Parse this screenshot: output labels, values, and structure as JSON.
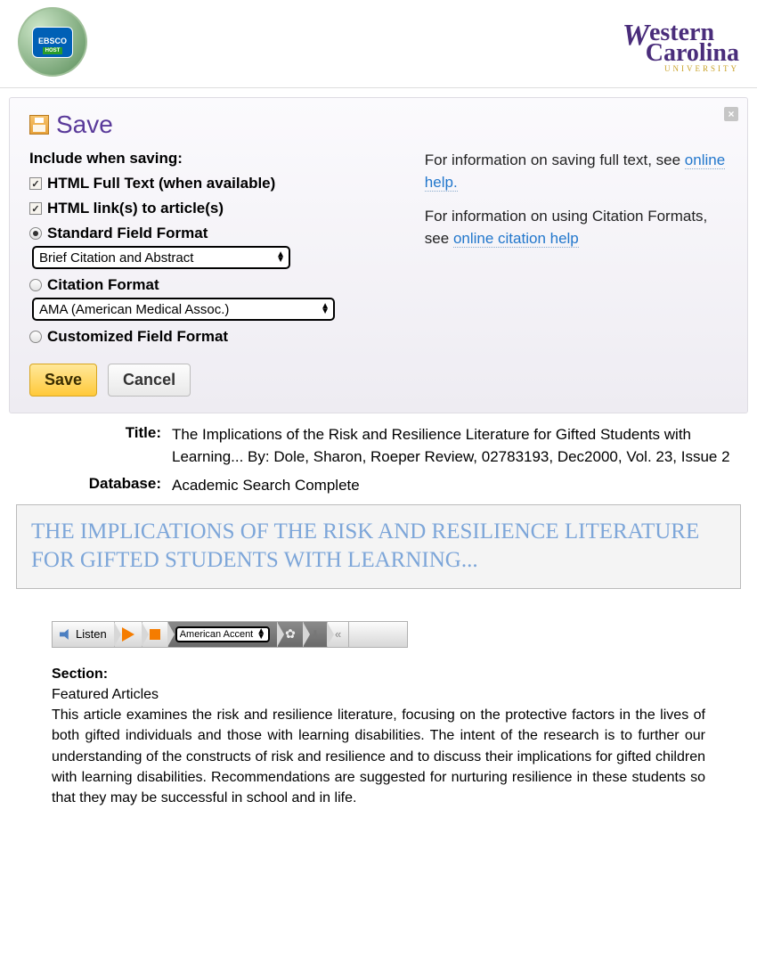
{
  "header": {
    "ebsco_label": "EBSCO",
    "ebsco_sub": "HOST",
    "wcu_line1a": "W",
    "wcu_line1b": "estern",
    "wcu_line2": "Carolina",
    "wcu_sub": "UNIVERSITY"
  },
  "panel": {
    "title": "Save",
    "subtitle": "Include when saving:",
    "opt_fulltext": "HTML Full Text (when available)",
    "opt_links": "HTML link(s) to article(s)",
    "opt_standard": "Standard Field Format",
    "select_standard": "Brief Citation and Abstract",
    "opt_citation": "Citation Format",
    "select_citation": "AMA (American Medical Assoc.)",
    "opt_custom": "Customized Field Format",
    "help1_pre": "For information on saving full text, see ",
    "help1_link": "online help.",
    "help2_pre": "For information on using Citation Formats, see ",
    "help2_link": "online citation help",
    "btn_save": "Save",
    "btn_cancel": "Cancel"
  },
  "meta": {
    "title_label": "Title:",
    "title_value": "The Implications of the Risk and Resilience Literature for Gifted Students with Learning... By: Dole, Sharon, Roeper Review, 02783193, Dec2000, Vol. 23, Issue 2",
    "db_label": "Database:",
    "db_value": "Academic Search Complete"
  },
  "article": {
    "headline": "THE IMPLICATIONS OF THE RISK AND RESILIENCE LITERATURE FOR GIFTED STUDENTS WITH LEARNING..."
  },
  "listen": {
    "label": "Listen",
    "accent": "American Accent",
    "collapse": "«"
  },
  "section": {
    "label": "Section:",
    "featured": "Featured Articles",
    "abstract": "This article examines the risk and resilience literature, focusing on the protective factors in the lives of both gifted individuals and those with learning disabilities. The intent of the research is to further our understanding of the constructs of risk and resilience and to discuss their implications for gifted children with learning disabilities. Recommendations are suggested for nurturing resilience in these students so that they may be successful in school and in life."
  }
}
